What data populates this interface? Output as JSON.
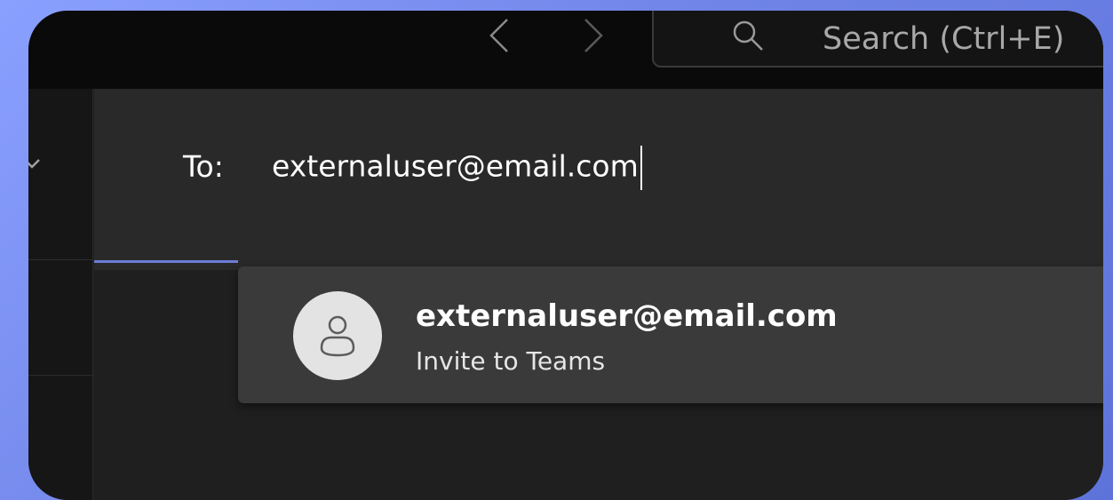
{
  "titlebar": {
    "search_placeholder": "Search (Ctrl+E)"
  },
  "compose": {
    "to_label": "To:",
    "to_value": "externaluser@email.com"
  },
  "suggestion": {
    "email": "externaluser@email.com",
    "subtitle": "Invite to Teams"
  },
  "icons": {
    "back": "chevron-left-icon",
    "forward": "chevron-right-icon",
    "search": "search-icon",
    "avatar": "person-icon",
    "rail": "chevron-down-icon"
  },
  "colors": {
    "accent": "#6e7bd9",
    "background": "#1f1f1f",
    "compose_bg": "#292929",
    "suggestion_bg": "#3a3a3a"
  }
}
